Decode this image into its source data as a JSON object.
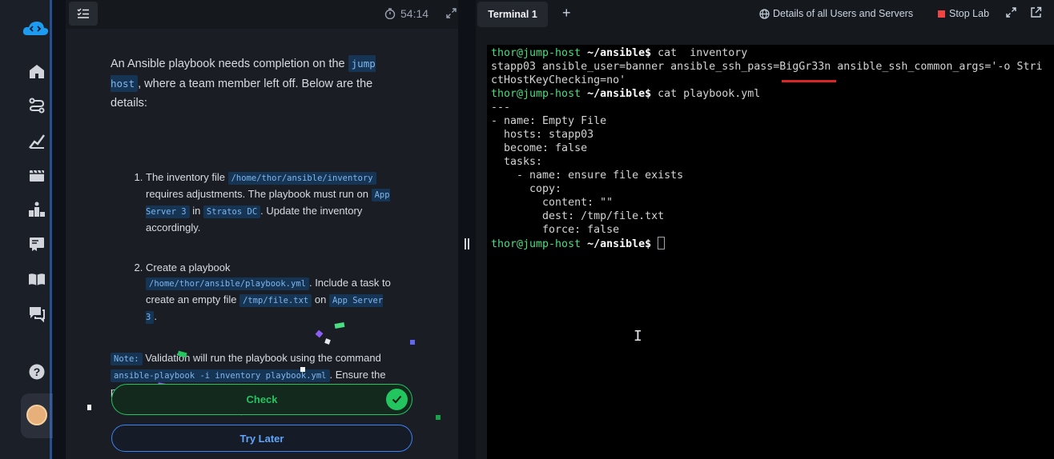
{
  "question": {
    "timer": "54:14",
    "intro_pre": "An Ansible playbook needs completion on the ",
    "intro_chip": "jump host",
    "intro_post": ", where a team member left off. Below are the details:",
    "item1": {
      "t1": "The inventory file ",
      "c1": "/home/thor/ansible/inventory",
      "t2": " requires adjustments. The playbook must run on ",
      "c2": "App Server 3",
      "t3": " in ",
      "c3": "Stratos DC",
      "t4": ". Update the inventory accordingly."
    },
    "item2": {
      "t1": "Create a playbook ",
      "c1": "/home/thor/ansible/playbook.yml",
      "t2": ". Include a task to create an empty file ",
      "c2": "/tmp/file.txt",
      "t3": " on ",
      "c3": "App Server 3",
      "t4": "."
    },
    "note": {
      "label": "Note:",
      "t1": " Validation will run the playbook using the command ",
      "cmd": "ansible-playbook -i inventory playbook.yml",
      "t2": ". Ensure the playbook works without any additional arguments."
    },
    "check_label": "Check",
    "later_label": "Try Later"
  },
  "terminal": {
    "tab_label": "Terminal 1",
    "add_tab": "+",
    "details_link": "Details of all Users and Servers",
    "stop_lab": "Stop Lab",
    "prompt_user": "thor@jump-host",
    "prompt_path": "~/ansible$",
    "cmd1": " cat  inventory",
    "out1a": "stapp03 ansible_user=banner ansible_ssh_pass=BigGr33n ansible_ssh_common_args='-o Stri",
    "out1b": "ctHostKeyChecking=no'",
    "cmd2": " cat playbook.yml",
    "yaml": "---\n- name: Empty File\n  hosts: stapp03\n  become: false\n  tasks:\n    - name: ensure file exists\n      copy:\n        content: \"\"\n        dest: /tmp/file.txt\n        force: false",
    "cmd3": " "
  },
  "colors": {
    "accent_blue": "#3b82f6",
    "success_green": "#22c55e",
    "prompt_green": "#4ade80",
    "stop_red": "#ef4444",
    "chip_bg": "#163554"
  },
  "icons": [
    "cloud-logo-icon",
    "home-icon",
    "route-icon",
    "chart-icon",
    "video-icon",
    "leaderboard-icon",
    "certificate-icon",
    "book-icon",
    "chat-icon",
    "help-icon",
    "stopwatch-icon",
    "expand-icon",
    "globe-icon",
    "fullscreen-icon",
    "external-link-icon",
    "check-icon",
    "list-icon"
  ]
}
